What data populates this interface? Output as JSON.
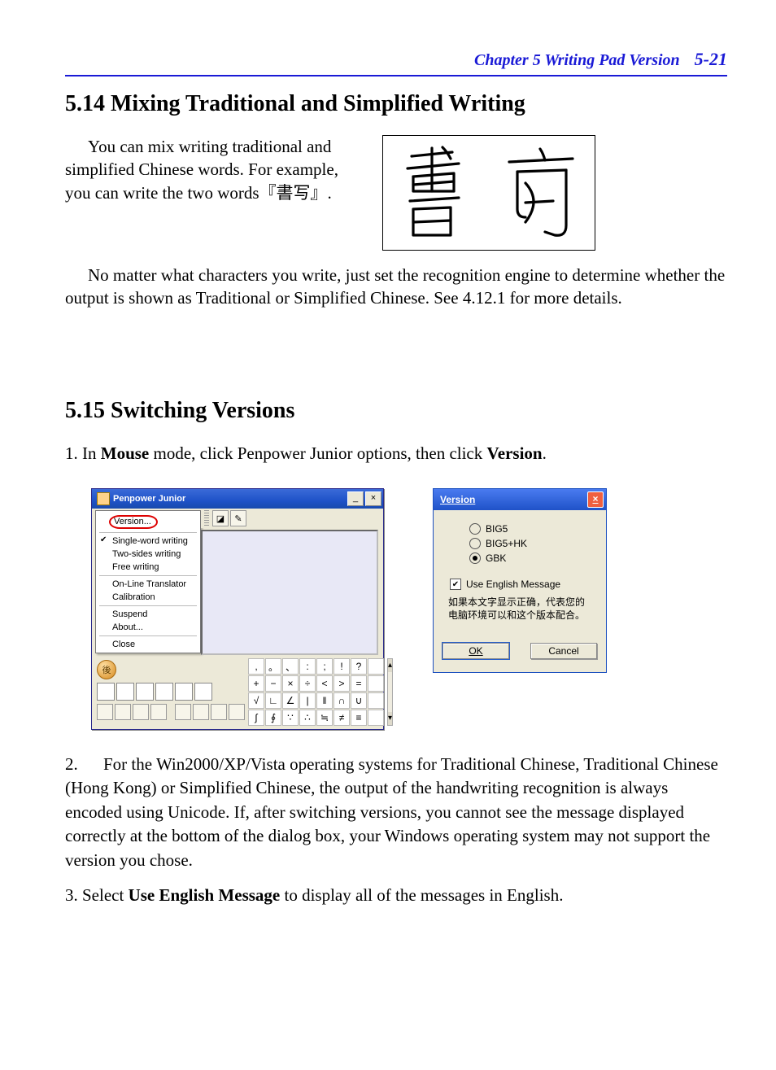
{
  "header": {
    "chapter": "Chapter 5 Writing Pad Version",
    "page": "5-21"
  },
  "section14": {
    "title": "5.14  Mixing Traditional and Simplified Writing",
    "p1": "You can mix writing traditional and simplified Chinese words. For example, you can write the two words『書写』.",
    "p2": "No matter what characters you write, just set the recognition engine to determine whether the output is shown as Traditional or Simplified Chinese. See 4.12.1 for more details."
  },
  "section15": {
    "title": "5.15  Switching Versions",
    "step1_pre": "1. In ",
    "step1_b1": "Mouse",
    "step1_mid": " mode, click Penpower Junior options, then click ",
    "step1_b2": "Version",
    "step1_post": ".",
    "step2_pre": "2. ",
    "step2_body": "For the Win2000/XP/Vista operating systems for Traditional Chinese, Traditional Chinese (Hong Kong) or Simplified Chinese, the output of the handwriting recognition is always encoded using Unicode. If, after switching versions, you cannot see the message displayed correctly at the bottom of the dialog box, your Windows operating system may not support the version you chose.",
    "step3_pre": "3. Select ",
    "step3_b": "Use English Message",
    "step3_post": " to display all of the messages in English."
  },
  "penpower": {
    "title": "Penpower Junior",
    "menu": {
      "version": "Version...",
      "single": "Single-word writing",
      "two": "Two-sides writing",
      "free": "Free writing",
      "translator": "On-Line Translator",
      "calibration": "Calibration",
      "suspend": "Suspend",
      "about": "About...",
      "close": "Close"
    },
    "round_btn": "後",
    "symbols": [
      ",",
      "。",
      "、",
      ":",
      ";",
      "!",
      "?",
      "",
      "+",
      "−",
      "×",
      "÷",
      "<",
      ">",
      "=",
      "",
      "√",
      "∟",
      "∠",
      "|",
      "‖",
      "∩",
      "∪",
      "",
      "∫",
      "∮",
      "∵",
      "∴",
      "≒",
      "≠",
      "≡",
      ""
    ]
  },
  "dialog": {
    "title": "Version",
    "opt_big5": "BIG5",
    "opt_big5hk": "BIG5+HK",
    "opt_gbk": "GBK",
    "use_english": "Use English Message",
    "msg": "如果本文字显示正确，代表您的电脑环境可以和这个版本配合。",
    "ok": "OK",
    "cancel": "Cancel"
  }
}
